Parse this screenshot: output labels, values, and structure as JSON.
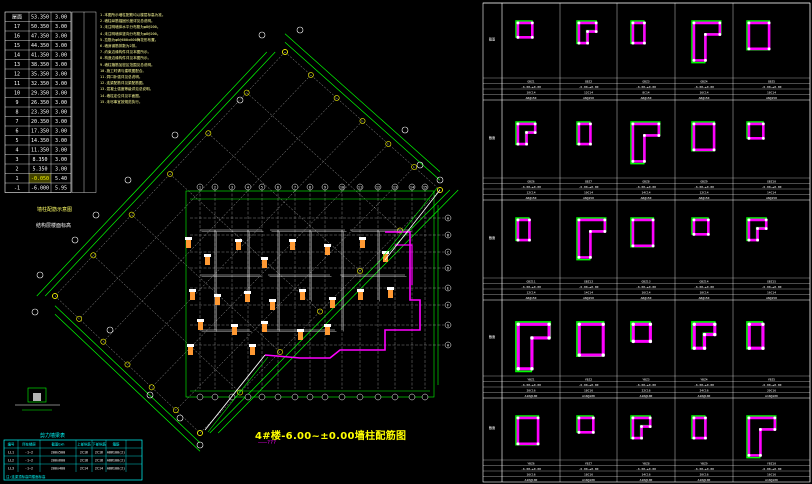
{
  "drawing": {
    "title": "4#楼-6.00~±0.00墙柱配筋图",
    "subtitle": "———???",
    "legend_title": "剪力墙梁表",
    "left_caption": "墙柱配筋示意图",
    "detail_caption": "结构层楼面标高"
  },
  "floor_table": {
    "rows": [
      {
        "floor": "屋面",
        "elev": "53.350",
        "h": "3.00"
      },
      {
        "floor": "17",
        "elev": "50.350",
        "h": "3.00"
      },
      {
        "floor": "16",
        "elev": "47.350",
        "h": "3.00"
      },
      {
        "floor": "15",
        "elev": "44.350",
        "h": "3.00"
      },
      {
        "floor": "14",
        "elev": "41.350",
        "h": "3.00"
      },
      {
        "floor": "13",
        "elev": "38.350",
        "h": "3.00"
      },
      {
        "floor": "12",
        "elev": "35.350",
        "h": "3.00"
      },
      {
        "floor": "11",
        "elev": "32.350",
        "h": "3.00"
      },
      {
        "floor": "10",
        "elev": "29.350",
        "h": "3.00"
      },
      {
        "floor": "9",
        "elev": "26.350",
        "h": "3.00"
      },
      {
        "floor": "8",
        "elev": "23.350",
        "h": "3.00"
      },
      {
        "floor": "7",
        "elev": "20.350",
        "h": "3.00"
      },
      {
        "floor": "6",
        "elev": "17.350",
        "h": "3.00"
      },
      {
        "floor": "5",
        "elev": "14.350",
        "h": "3.00"
      },
      {
        "floor": "4",
        "elev": "11.350",
        "h": "3.00"
      },
      {
        "floor": "3",
        "elev": "8.350",
        "h": "3.00"
      },
      {
        "floor": "2",
        "elev": "5.350",
        "h": "3.00"
      },
      {
        "floor": "1",
        "elev": "-0.050",
        "h": "5.40"
      },
      {
        "floor": "-1",
        "elev": "-6.000",
        "h": "5.95"
      }
    ]
  },
  "notes": [
    "1.本图所示墙柱配筋均以楼层标高为准。",
    "2.墙柱纵筋锚固长度详见总说明。",
    "3.未注明墙体水平分布筋为φ8@200。",
    "4.未注明墙体竖向分布筋为φ8@200。",
    "5.拉筋为φ6@600x600梅花形布置。",
    "6.墙身钢筋排数为2排。",
    "7.约束边缘构件详见本图所示。",
    "8.构造边缘构件详见本图所示。",
    "9.墙柱箍筋加密区范围见总说明。",
    "10.施工时请与建筑图配合。",
    "11.洞口补强详见总说明。",
    "12.连梁配筋详见梁配筋图。",
    "13.混凝土强度等级详见总说明。",
    "14.墙柱定位详见平面图。",
    "15.未尽事宜按规范执行。"
  ],
  "legend_table": {
    "headers": [
      "编号",
      "所在楼层",
      "截面bxh",
      "上部纵筋",
      "下部纵筋",
      "箍筋"
    ],
    "rows": [
      [
        "LL1",
        "-1~2",
        "200x500",
        "2C16",
        "2C16",
        "A8@100(2)"
      ],
      [
        "LL2",
        "-1~2",
        "200x600",
        "2C18",
        "2C18",
        "A8@100(2)"
      ],
      [
        "LL3",
        "-1~2",
        "200x400",
        "2C14",
        "2C14",
        "A8@100(2)"
      ]
    ],
    "footer": "注:连梁顶标高同楼面标高"
  },
  "axis_labels": {
    "top": [
      "1",
      "2",
      "3",
      "4",
      "5",
      "6",
      "7",
      "8",
      "9",
      "10",
      "11",
      "12",
      "13",
      "14",
      "15"
    ],
    "right": [
      "A",
      "B",
      "C",
      "D",
      "E",
      "F",
      "G",
      "H"
    ]
  },
  "section_table": {
    "rows": [
      {
        "labels": [
          "GBZ1",
          "GBZ2",
          "GBZ3",
          "GBZ4",
          "GBZ5"
        ],
        "elev": [
          "-6.00~±0.00",
          "-6.00~±0.00",
          "-6.00~±0.00",
          "-6.00~±0.00",
          "-6.00~±0.00"
        ],
        "rebar": [
          "10C14",
          "12C14",
          "8C14",
          "16C14",
          "18C14"
        ],
        "stirrup": [
          "A8@150",
          "A8@150",
          "A8@150",
          "A8@150",
          "A8@150"
        ]
      },
      {
        "labels": [
          "GBZ6",
          "GBZ7",
          "GBZ8",
          "GBZ9",
          "GBZ10"
        ],
        "elev": [
          "-6.00~±0.00",
          "-6.00~±0.00",
          "-6.00~±0.00",
          "-6.00~±0.00",
          "-6.00~±0.00"
        ],
        "rebar": [
          "12C14",
          "10C14",
          "14C14",
          "12C14",
          "14C14"
        ],
        "stirrup": [
          "A8@150",
          "A8@150",
          "A8@150",
          "A8@150",
          "A8@150"
        ]
      },
      {
        "labels": [
          "GBZ11",
          "GBZ12",
          "GBZ13",
          "GBZ14",
          "GBZ15"
        ],
        "elev": [
          "-6.00~±0.00",
          "-6.00~±0.00",
          "-6.00~±0.00",
          "-6.00~±0.00",
          "-6.00~±0.00"
        ],
        "rebar": [
          "12C14",
          "14C14",
          "16C14",
          "10C14",
          "16C14"
        ],
        "stirrup": [
          "A8@150",
          "A8@150",
          "A8@150",
          "A8@150",
          "A8@150"
        ]
      },
      {
        "labels": [
          "YBZ1",
          "YBZ2",
          "YBZ3",
          "YBZ4",
          "YBZ5"
        ],
        "elev": [
          "-6.00~±0.00",
          "-6.00~±0.00",
          "-6.00~±0.00",
          "-6.00~±0.00",
          "-6.00~±0.00"
        ],
        "rebar": [
          "20C16",
          "18C16",
          "22C16",
          "24C16",
          "20C16"
        ],
        "stirrup": [
          "A10@100",
          "A10@100",
          "A10@100",
          "A10@100",
          "A10@100"
        ]
      },
      {
        "labels": [
          "YBZ6",
          "YBZ7",
          "YBZ8",
          "YBZ9",
          "YBZ10"
        ],
        "elev": [
          "-6.00~±0.00",
          "-6.00~±0.00",
          "-6.00~±0.00",
          "-6.00~±0.00",
          "-6.00~±0.00"
        ],
        "rebar": [
          "16C16",
          "18C16",
          "14C16",
          "20C16",
          "16C16"
        ],
        "stirrup": [
          "A10@100",
          "A10@100",
          "A10@100",
          "A10@100",
          "A10@100"
        ]
      }
    ]
  },
  "colors": {
    "grid_green": "#00ff00",
    "axis_dash": "#aaaaaa",
    "wall_pink": "#ff00ff",
    "column_orange": "#ff9933",
    "table_cyan": "#00ffff",
    "text_white": "#ffffff",
    "bubble_yellow": "#ffff00"
  }
}
